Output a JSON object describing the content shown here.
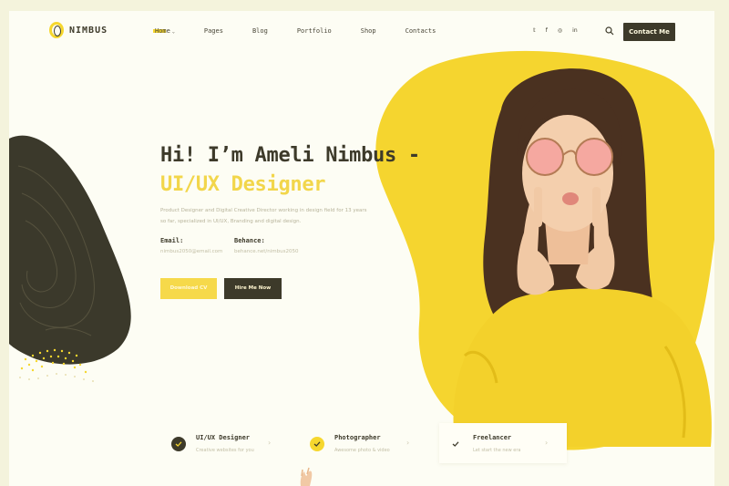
{
  "brand": {
    "name": "NIMBUS"
  },
  "nav": {
    "items": [
      {
        "label": "Home",
        "active": true
      },
      {
        "label": "Pages"
      },
      {
        "label": "Blog"
      },
      {
        "label": "Portfolio"
      },
      {
        "label": "Shop"
      },
      {
        "label": "Contacts"
      }
    ],
    "chevron": "⌄"
  },
  "socials": {
    "twitter": "𝕥",
    "facebook": "f",
    "instagram": "◎",
    "linkedin": "in"
  },
  "header": {
    "contact_label": "Contact Me"
  },
  "hero": {
    "title": "Hi! I’m Ameli Nimbus -",
    "subtitle": "UI/UX Designer",
    "description": "Product Designer and Digital Creative Director working in design field for 13 years so far, specialized in UI/UX, Branding and digital design.",
    "email_label": "Email:",
    "email_value": "nimbus2050@email.com",
    "behance_label": "Behance:",
    "behance_value": "behance.net/nimbus2050",
    "download_label": "Download CV",
    "hire_label": "Hire Me Now"
  },
  "services": [
    {
      "title": "UI/UX Designer",
      "desc": "Creative websites for you",
      "icon": "check-icon"
    },
    {
      "title": "Photographer",
      "desc": "Awesome photo & video",
      "icon": "check-icon"
    },
    {
      "title": "Freelancer",
      "desc": "Let start the new era",
      "icon": "check-icon"
    }
  ],
  "colors": {
    "accent": "#f6d72e",
    "dark": "#3d3a2a",
    "background": "#fdfdf4"
  }
}
